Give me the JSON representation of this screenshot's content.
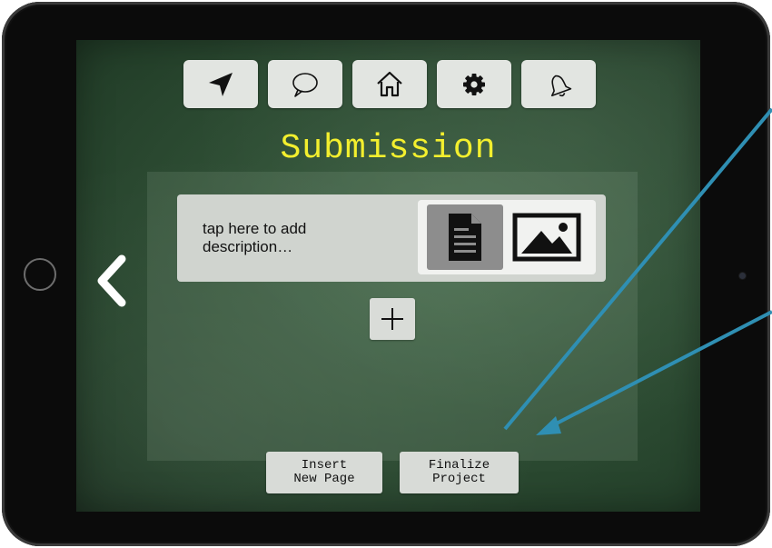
{
  "toolbar": {
    "items": [
      {
        "icon": "location-arrow-icon"
      },
      {
        "icon": "chat-bubble-icon"
      },
      {
        "icon": "home-icon"
      },
      {
        "icon": "gear-icon"
      },
      {
        "icon": "bell-icon"
      }
    ]
  },
  "page": {
    "title": "Submission"
  },
  "submission_item": {
    "description_placeholder": "tap here to add description…",
    "type_options": [
      {
        "icon": "document-icon",
        "selected": true
      },
      {
        "icon": "image-icon",
        "selected": false
      }
    ]
  },
  "actions": {
    "add_icon": "plus-icon",
    "back_icon": "chevron-left-icon",
    "insert_label": "Insert\nNew Page",
    "finalize_label": "Finalize\nProject"
  },
  "colors": {
    "title": "#f3ef2e",
    "chalkboard": "#2f4f35",
    "annotation_arrow": "#2f8fb3"
  }
}
